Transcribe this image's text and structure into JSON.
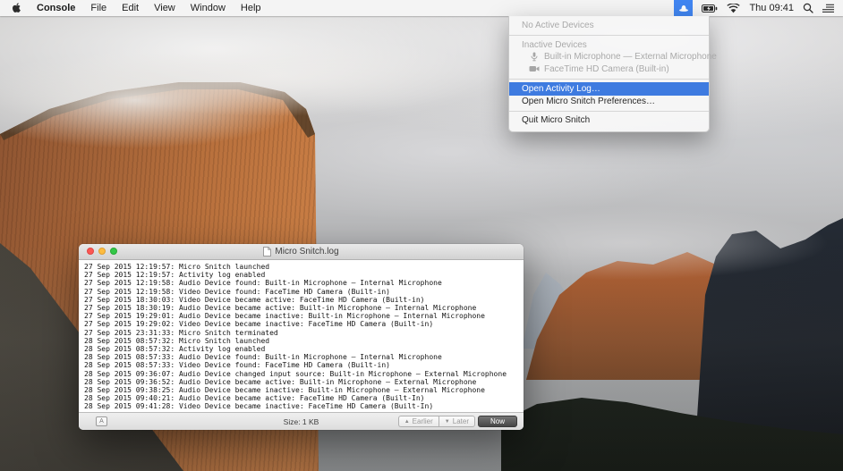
{
  "menu_bar": {
    "app_name": "Console",
    "menus": [
      "File",
      "Edit",
      "View",
      "Window",
      "Help"
    ],
    "time": "Thu 09:41"
  },
  "menu_extra": {
    "items": {
      "no_active": "No Active Devices",
      "inactive_header": "Inactive Devices",
      "mic": "Built-in Microphone — External Microphone",
      "camera": "FaceTime HD Camera (Built-in)",
      "open_log": "Open Activity Log…",
      "open_prefs": "Open Micro Snitch Preferences…",
      "quit": "Quit Micro Snitch"
    }
  },
  "console_window": {
    "title": "Micro Snitch.log",
    "log_lines": [
      "27 Sep 2015 12:19:57: Micro Snitch launched",
      "27 Sep 2015 12:19:57: Activity log enabled",
      "27 Sep 2015 12:19:58: Audio Device found: Built-in Microphone — Internal Microphone",
      "27 Sep 2015 12:19:58: Video Device found: FaceTime HD Camera (Built-in)",
      "27 Sep 2015 18:30:03: Video Device became active: FaceTime HD Camera (Built-in)",
      "27 Sep 2015 18:30:19: Audio Device became active: Built-in Microphone — Internal Microphone",
      "27 Sep 2015 19:29:01: Audio Device became inactive: Built-in Microphone — Internal Microphone",
      "27 Sep 2015 19:29:02: Video Device became inactive: FaceTime HD Camera (Built-in)",
      "27 Sep 2015 23:31:33: Micro Snitch terminated",
      "28 Sep 2015 08:57:32: Micro Snitch launched",
      "28 Sep 2015 08:57:32: Activity log enabled",
      "28 Sep 2015 08:57:33: Audio Device found: Built-in Microphone — Internal Microphone",
      "28 Sep 2015 08:57:33: Video Device found: FaceTime HD Camera (Built-in)",
      "28 Sep 2015 09:36:07: Audio Device changed input source: Built-in Microphone — External Microphone",
      "28 Sep 2015 09:36:52: Audio Device became active: Built-in Microphone — External Microphone",
      "28 Sep 2015 09:38:25: Audio Device became inactive: Built-in Microphone — External Microphone",
      "28 Sep 2015 09:40:21: Audio Device became active: FaceTime HD Camera (Built-In)",
      "28 Sep 2015 09:41:28: Video Device became inactive: FaceTime HD Camera (Built-In)"
    ],
    "status": {
      "encoding_button": "A",
      "size": "Size: 1 KB",
      "earlier": "Earlier",
      "later": "Later",
      "now": "Now",
      "earlier_arrow": "▲",
      "later_arrow": "▼"
    }
  },
  "colors": {
    "menu_highlight": "#3e7be0",
    "menu_extra_active": "#4186f2",
    "traffic_red": "#fc5753",
    "traffic_yellow": "#fdbc40",
    "traffic_green": "#33c748"
  }
}
